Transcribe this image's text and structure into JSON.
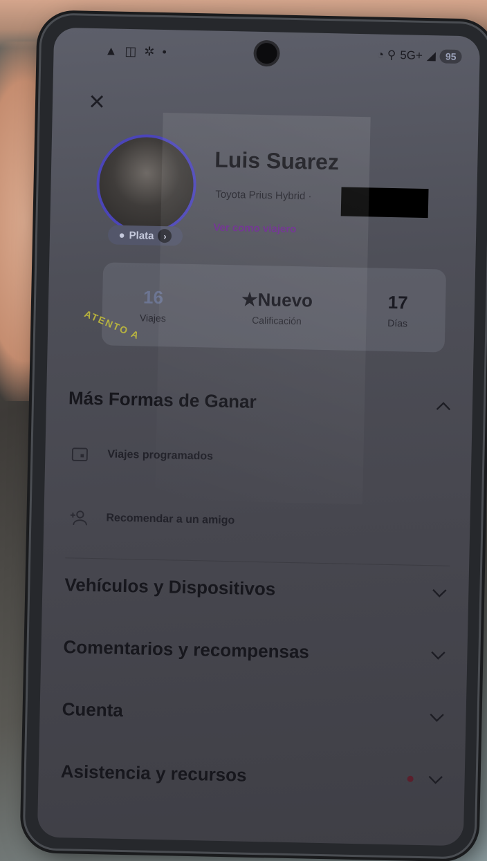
{
  "status_bar": {
    "left_icons": "▲ ◫ ✲ •",
    "right_text": "5G+",
    "battery": "95"
  },
  "profile": {
    "name": "Luis Suarez",
    "vehicle": "Toyota Prius Hybrid ·",
    "view_as_label": "Ver como viajero",
    "tier": "Plata"
  },
  "stats": [
    {
      "value": "16",
      "label": "Viajes"
    },
    {
      "value": "★Nuevo",
      "label": "Calificación"
    },
    {
      "value": "17",
      "label": "Días"
    }
  ],
  "sections": {
    "more_ways": {
      "title": "Más Formas de Ganar",
      "items": [
        {
          "label": "Viajes programados",
          "icon": "calendar-icon"
        },
        {
          "label": "Recomendar a un amigo",
          "icon": "add-user-icon"
        }
      ]
    },
    "vehicles": {
      "title": "Vehículos y Dispositivos"
    },
    "feedback": {
      "title": "Comentarios y recompensas"
    },
    "account": {
      "title": "Cuenta"
    },
    "support": {
      "title": "Asistencia y recursos"
    }
  },
  "decal_text": "ATENTO A"
}
